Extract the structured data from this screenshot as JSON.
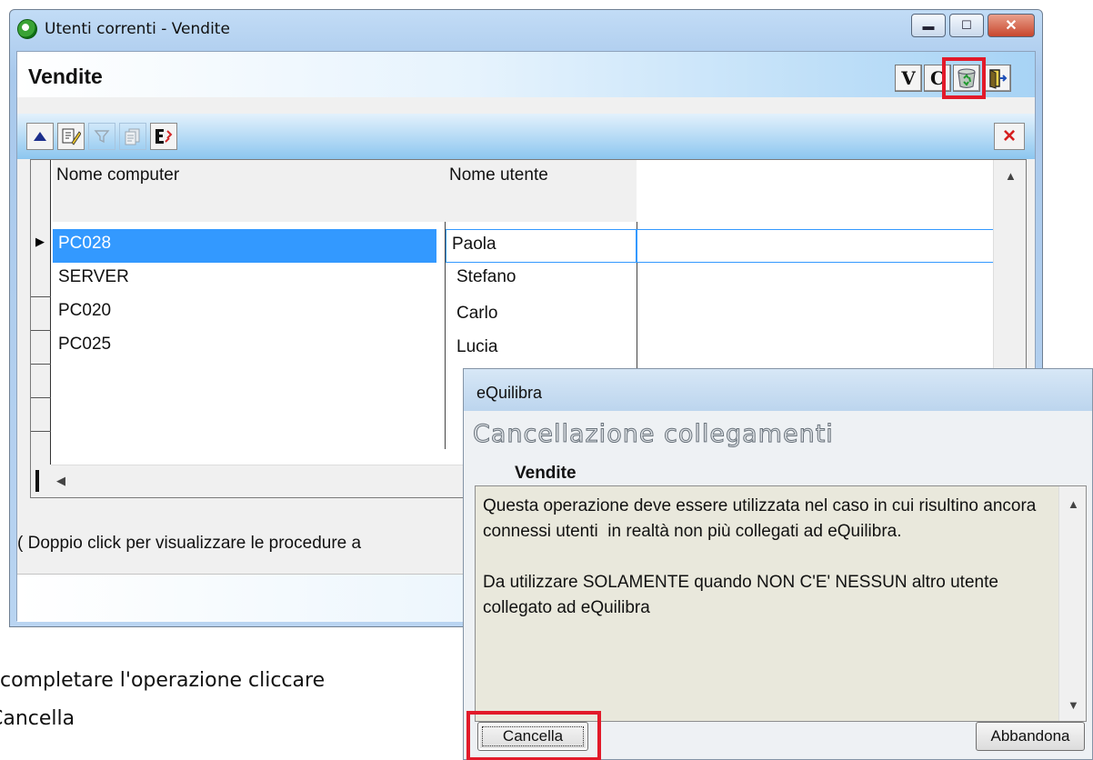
{
  "main_window": {
    "title": "Utenti correnti - Vendite",
    "header_title": "Vendite",
    "header_buttons": [
      {
        "label": "V",
        "name": "view-button"
      },
      {
        "label": "C",
        "name": "copy-button"
      },
      {
        "icon": "recycle-bin-icon",
        "name": "delete-connections-button",
        "highlighted": true
      },
      {
        "icon": "exit-door-icon",
        "name": "exit-button"
      }
    ],
    "toolbar_icons": [
      "arrow-up-icon",
      "edit-filter-icon",
      "filter-icon",
      "copy-records-icon",
      "export-icon"
    ],
    "close_icon_label": "×",
    "columns": [
      "Nome computer",
      "Nome utente"
    ],
    "rows": [
      {
        "computer": "PC028",
        "user": "Paola",
        "selected": true
      },
      {
        "computer": "SERVER",
        "user": "Stefano"
      },
      {
        "computer": "PC020",
        "user": "Carlo"
      },
      {
        "computer": "PC025",
        "user": "Lucia"
      }
    ],
    "hint": "( Doppio click per visualizzare le procedure a"
  },
  "instruction": {
    "line1": "completare l'operazione cliccare",
    "line2": "Cancella"
  },
  "dialog": {
    "title": "eQuilibra",
    "heading": "Cancellazione collegamenti",
    "subtitle": "Vendite",
    "message": "Questa operazione deve essere utilizzata nel caso in cui risultino ancora connessi utenti  in realtà non più collegati ad eQuilibra.\n\nDa utilizzare SOLAMENTE quando NON C'E' NESSUN altro utente collegato ad eQuilibra",
    "ok_label": "Cancella",
    "cancel_label": "Abbandona"
  },
  "colors": {
    "highlight": "#e21a2a",
    "selection": "#3399ff"
  }
}
